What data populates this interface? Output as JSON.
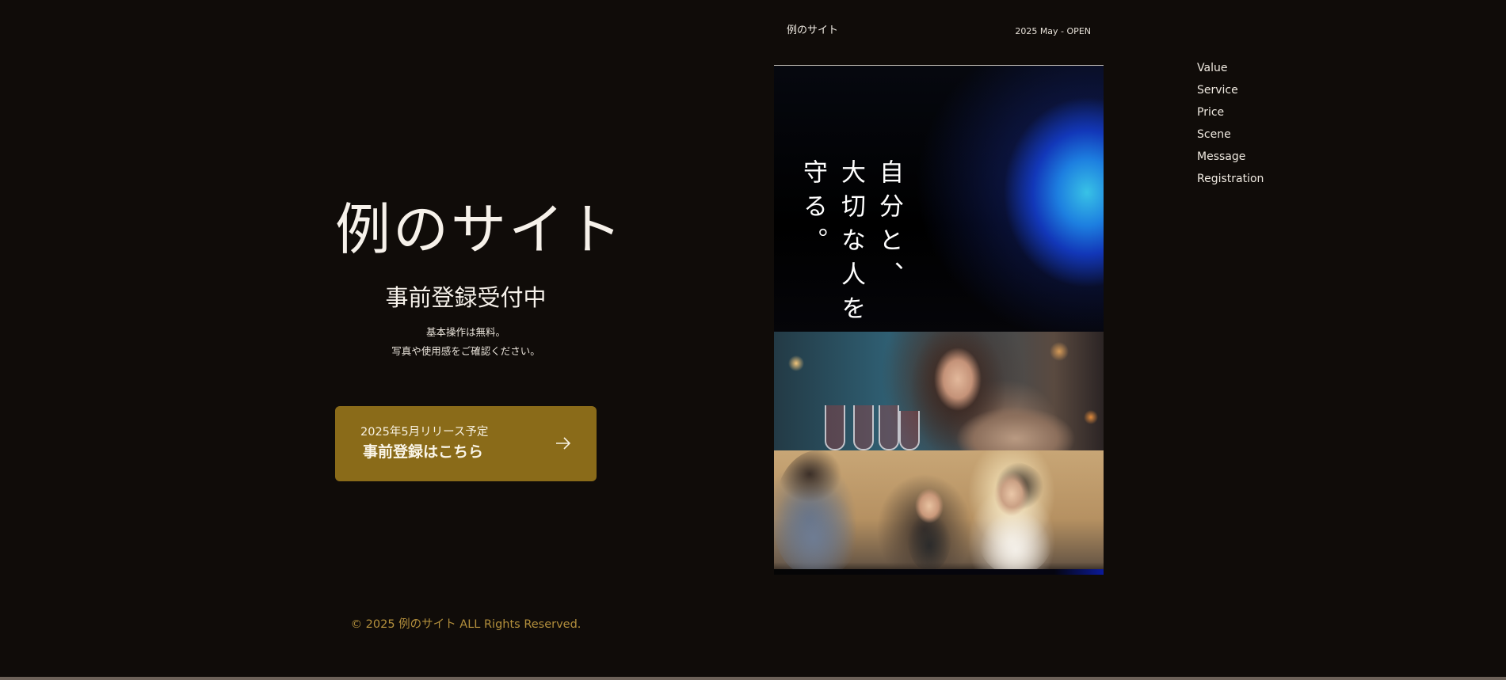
{
  "hero": {
    "title": "例のサイト",
    "subtitle": "事前登録受付中",
    "description_lines": [
      "基本操作は無料。",
      "写真や使用感をご確認ください。"
    ]
  },
  "cta": {
    "small_label": "2025年5月リリース予定",
    "main_label": "事前登録はこちら",
    "icon": "arrow-right-icon",
    "background_color": "#8a6b19"
  },
  "panel": {
    "logo": "例のサイト",
    "open_date": "2025 May - OPEN",
    "key_copy_columns": [
      "自分と、",
      "大切な人を",
      "守る。"
    ]
  },
  "nav": {
    "items": [
      "Value",
      "Service",
      "Price",
      "Scene",
      "Message",
      "Registration"
    ]
  },
  "footer": {
    "copyright": "© 2025 例のサイト ALL Rights Reserved.",
    "copyright_color": "#b38f3c"
  }
}
